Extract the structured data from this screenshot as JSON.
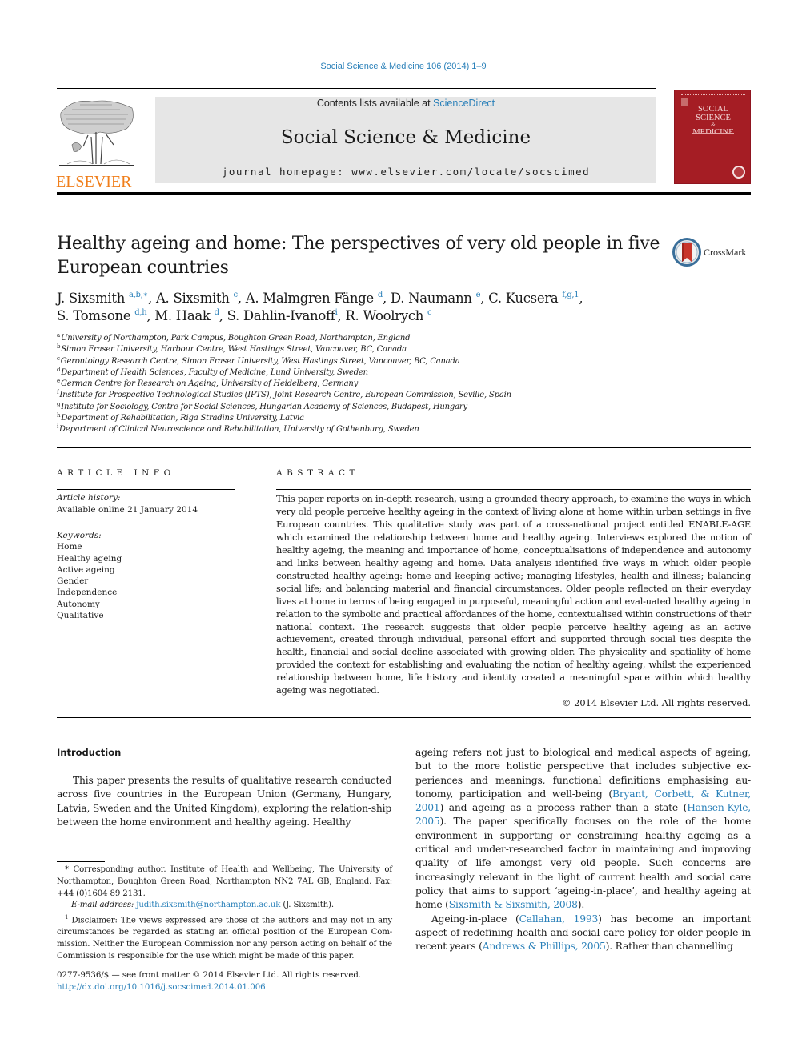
{
  "header": {
    "journal_reference": "Social Science & Medicine 106 (2014) 1–9",
    "contents_prefix": "Contents lists available at ",
    "contents_link": "ScienceDirect",
    "journal_title": "Social Science & Medicine",
    "homepage_prefix": "journal homepage: ",
    "homepage_url": "www.elsevier.com/locate/socscimed",
    "publisher_logo_text": "ELSEVIER",
    "cover_title_lines": [
      "SOCIAL",
      "SCIENCE",
      "&",
      "MEDICINE"
    ],
    "colors": {
      "link": "#2a80b9",
      "elsevier_orange": "#f07e1a",
      "cover_red": "#a51d24",
      "masthead_gray": "#e6e6e6"
    }
  },
  "article": {
    "title": "Healthy ageing and home: The perspectives of very old people in five European countries",
    "crossmark_label": "CrossMark",
    "authors": [
      {
        "name": "J. Sixsmith",
        "sup": "a,b,∗"
      },
      {
        "name": "A. Sixsmith",
        "sup": "c"
      },
      {
        "name": "A. Malmgren Fänge",
        "sup": "d"
      },
      {
        "name": "D. Naumann",
        "sup": "e"
      },
      {
        "name": "C. Kucsera",
        "sup": "f,g,1"
      },
      {
        "name": "S. Tomsone",
        "sup": "d,h"
      },
      {
        "name": "M. Haak",
        "sup": "d"
      },
      {
        "name": "S. Dahlin-Ivanoff",
        "sup": "i"
      },
      {
        "name": "R. Woolrych",
        "sup": "c"
      }
    ],
    "affiliations": [
      {
        "key": "a",
        "text": "University of Northampton, Park Campus, Boughton Green Road, Northampton, England"
      },
      {
        "key": "b",
        "text": "Simon Fraser University, Harbour Centre, West Hastings Street, Vancouver, BC, Canada"
      },
      {
        "key": "c",
        "text": "Gerontology Research Centre, Simon Fraser University, West Hastings Street, Vancouver, BC, Canada"
      },
      {
        "key": "d",
        "text": "Department of Health Sciences, Faculty of Medicine, Lund University, Sweden"
      },
      {
        "key": "e",
        "text": "German Centre for Research on Ageing, University of Heidelberg, Germany"
      },
      {
        "key": "f",
        "text": "Institute for Prospective Technological Studies (IPTS), Joint Research Centre, European Commission, Seville, Spain"
      },
      {
        "key": "g",
        "text": "Institute for Sociology, Centre for Social Sciences, Hungarian Academy of Sciences, Budapest, Hungary"
      },
      {
        "key": "h",
        "text": "Department of Rehabilitation, Riga Stradins University, Latvia"
      },
      {
        "key": "i",
        "text": "Department of Clinical Neuroscience and Rehabilitation, University of Gothenburg, Sweden"
      }
    ]
  },
  "article_info": {
    "heading": "ARTICLE INFO",
    "history_label": "Article history:",
    "history_value": "Available online 21 January 2014",
    "keywords_label": "Keywords:",
    "keywords": [
      "Home",
      "Healthy ageing",
      "Active ageing",
      "Gender",
      "Independence",
      "Autonomy",
      "Qualitative"
    ]
  },
  "abstract": {
    "heading": "ABSTRACT",
    "text": "This paper reports on in-depth research, using a grounded theory approach, to examine the ways in which very old people perceive healthy ageing in the context of living alone at home within urban settings in five European countries. This qualitative study was part of a cross-national project entitled ENABLE-AGE which examined the relationship between home and healthy ageing. Interviews explored the notion of healthy ageing, the meaning and importance of home, conceptualisations of independence and autonomy and links between healthy ageing and home. Data analysis identified five ways in which older people constructed healthy ageing: home and keeping active; managing lifestyles, health and illness; balancing social life; and balancing material and financial circumstances. Older people reflected on their everyday lives at home in terms of being engaged in purposeful, meaningful action and eval-uated healthy ageing in relation to the symbolic and practical affordances of the home, contextualised within constructions of their national context. The research suggests that older people perceive healthy ageing as an active achievement, created through individual, personal effort and supported through social ties despite the health, financial and social decline associated with growing older. The physicality and spatiality of home provided the context for establishing and evaluating the notion of healthy ageing, whilst the experienced relationship between home, life history and identity created a meaningful space within which healthy ageing was negotiated.",
    "copyright": "© 2014 Elsevier Ltd. All rights reserved."
  },
  "body": {
    "intro_heading": "Introduction",
    "left_paragraph": "This paper presents the results of qualitative research conducted across five countries in the European Union (Germany, Hungary, Latvia, Sweden and the United Kingdom), exploring the relation-ship between the home environment and healthy ageing. Healthy",
    "right_p1": {
      "t1": "ageing refers not just to biological and medical aspects of ageing, but to the more holistic perspective that includes subjective ex-periences and meanings, functional definitions emphasising au-tonomy, participation and well-being (",
      "c1": "Bryant, Corbett, & Kutner, 2001",
      "t2": ") and ageing as a process rather than a state (",
      "c2": "Hansen-Kyle, 2005",
      "t3": "). The paper specifically focuses on the role of the home environment in supporting or constraining healthy ageing as a critical and under-researched factor in maintaining and improving quality of life amongst very old people. Such concerns are increasingly relevant in the light of current health and social care policy that aims to support ‘ageing-in-place’, and healthy ageing at home (",
      "c3": "Sixsmith & Sixsmith, 2008",
      "t4": ")."
    },
    "right_p2": {
      "t1": "Ageing-in-place (",
      "c1": "Callahan, 1993",
      "t2": ") has become an important aspect of redefining health and social care policy for older people in recent years (",
      "c2": "Andrews & Phillips, 2005",
      "t3": "). Rather than channelling"
    }
  },
  "footnotes": {
    "corresponding_mark": "*",
    "corresponding": " Corresponding author. Institute of Health and Wellbeing, The University of Northampton, Boughton Green Road, Northampton NN2 7AL GB, England. Fax: +44 (0)1604 89 2131.",
    "email_label": "E-mail address: ",
    "email": "judith.sixsmith@northampton.ac.uk",
    "email_suffix": " (J. Sixsmith).",
    "disclaimer_mark": "1",
    "disclaimer": " Disclaimer: The views expressed are those of the authors and may not in any circumstances be regarded as stating an official position of the European Com-mission. Neither the European Commission nor any person acting on behalf of the Commission is responsible for the use which might be made of this paper."
  },
  "front_matter": {
    "issn_line": "0277-9536/$ — see front matter © 2014 Elsevier Ltd. All rights reserved.",
    "doi": "http://dx.doi.org/10.1016/j.socscimed.2014.01.006"
  }
}
